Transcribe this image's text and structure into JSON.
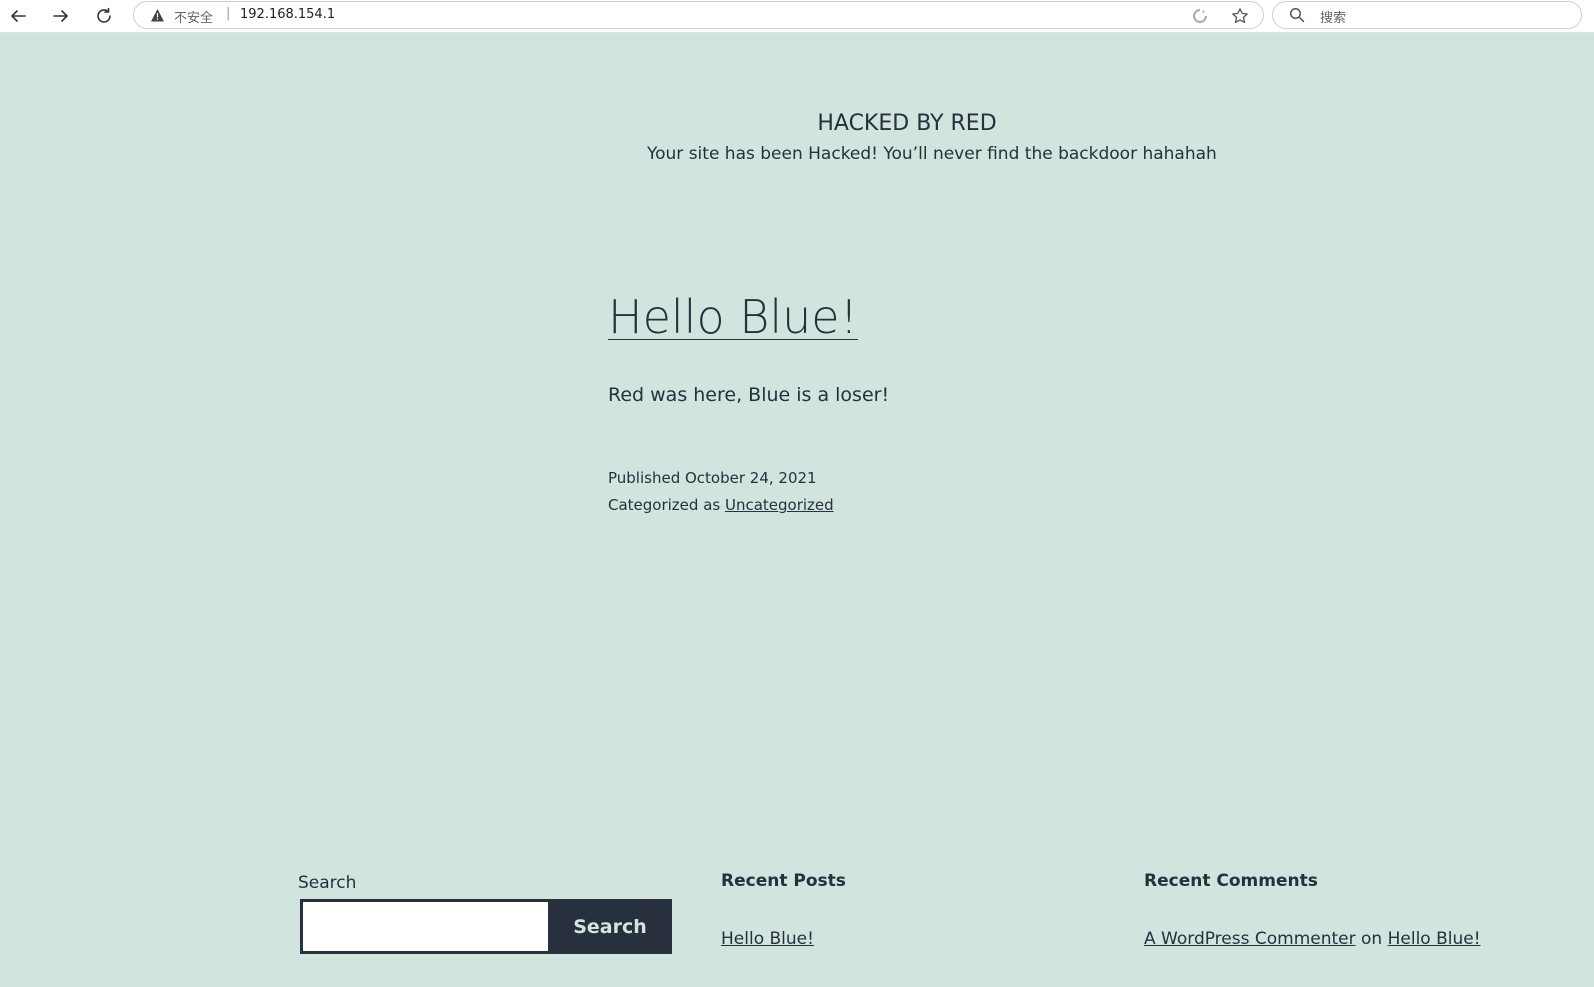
{
  "browser": {
    "insecure_label": "不安全",
    "separator": "|",
    "url": "192.168.154.1",
    "search_placeholder": "搜索"
  },
  "site": {
    "title": "HACKED BY RED",
    "description": "Your site has been Hacked! You’ll never find the backdoor hahahah"
  },
  "post": {
    "title": "Hello Blue!",
    "body": "Red was here, Blue is a loser!",
    "published": "Published October 24, 2021",
    "categorized_prefix": "Categorized as ",
    "category": "Uncategorized"
  },
  "footer": {
    "search_label": "Search",
    "search_button": "Search",
    "recent_posts_heading": "Recent Posts",
    "recent_posts": [
      "Hello Blue!"
    ],
    "recent_comments_heading": "Recent Comments",
    "comment_author": "A WordPress Commenter",
    "comment_on": " on ",
    "comment_post": "Hello Blue!"
  },
  "colors": {
    "background": "#d1e4dd",
    "text": "#28303d"
  }
}
